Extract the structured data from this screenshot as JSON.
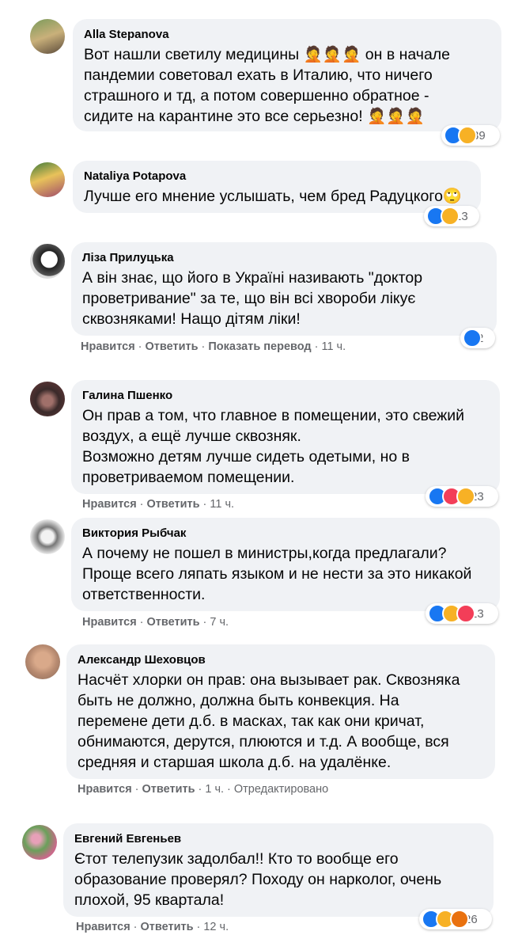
{
  "colors": {
    "bubble": "#f0f2f5",
    "meta_text": "#65676b",
    "like_blue": "#1877f2",
    "haha_yellow": "#f7b125",
    "love_red": "#f33e58",
    "angry_orange": "#e9710f"
  },
  "comments": [
    {
      "author": "Alla Stepanova",
      "text": "Вот нашли светилу медицины 🤦🤦🤦 он в начале\nпандемии советовал ехать в Италию, что ничего\nстрашного и тд, а потом совершенно обратное -\nсидите на карантине это все серьезно! 🤦🤦🤦",
      "reactions": [
        "like",
        "haha"
      ],
      "reaction_count": "39"
    },
    {
      "author": "Nataliya Potapova",
      "text": "Лучше его мнение услышать, чем бред Радуцкого🙄",
      "reactions": [
        "like",
        "haha"
      ],
      "reaction_count": "13"
    },
    {
      "author": "Ліза Прилуцька",
      "text": "А він знає, що його в Україні називають \"доктор\nпроветривание\" за те, що він всі хвороби лікує\nсквозняками! Нащо дітям ліки!",
      "reactions": [
        "like"
      ],
      "reaction_count": "2",
      "actions": {
        "like": "Нравится",
        "reply": "Ответить",
        "translate": "Показать перевод",
        "time": "11 ч."
      }
    },
    {
      "author": "Галина Пшенко",
      "text": "Он прав а том, что главное в помещении, это свежий\nвоздух, а ещё лучше сквозняк.\nВозможно детям лучше сидеть одетыми, но в\nпроветриваемом помещении.",
      "reactions": [
        "like",
        "love",
        "haha"
      ],
      "reaction_count": "23",
      "actions": {
        "like": "Нравится",
        "reply": "Ответить",
        "time": "11 ч."
      }
    },
    {
      "author": "Виктория Рыбчак",
      "text": "А почему не пошел в министры,когда предлагали?\nПроще всего ляпать языком и не нести за это никакой\nответственности.",
      "reactions": [
        "like",
        "haha",
        "love"
      ],
      "reaction_count": "13",
      "actions": {
        "like": "Нравится",
        "reply": "Ответить",
        "time": "7 ч."
      }
    },
    {
      "author": "Александр Шеховцов",
      "text": "Насчёт хлорки он прав: она вызывает рак. Сквозняка\nбыть не должно, должна быть конвекция. На\nперемене дети д.б. в масках, так как они кричат,\nобнимаются, дерутся, плюются и т.д. А вообще, вся\nсредняя и старшая школа д.б. на удалёнке.",
      "actions": {
        "like": "Нравится",
        "reply": "Ответить",
        "time": "1 ч.",
        "edited": "Отредактировано"
      }
    },
    {
      "author": "Евгений Евгеньев",
      "text": "Єтот телепузик задолбал!! Кто то вообще его\nобразование проверял? Походу он нарколог, очень\nплохой, 95 квартала!",
      "reactions": [
        "like",
        "haha",
        "angry"
      ],
      "reaction_count": "26",
      "actions": {
        "like": "Нравится",
        "reply": "Ответить",
        "time": "12 ч."
      }
    }
  ]
}
